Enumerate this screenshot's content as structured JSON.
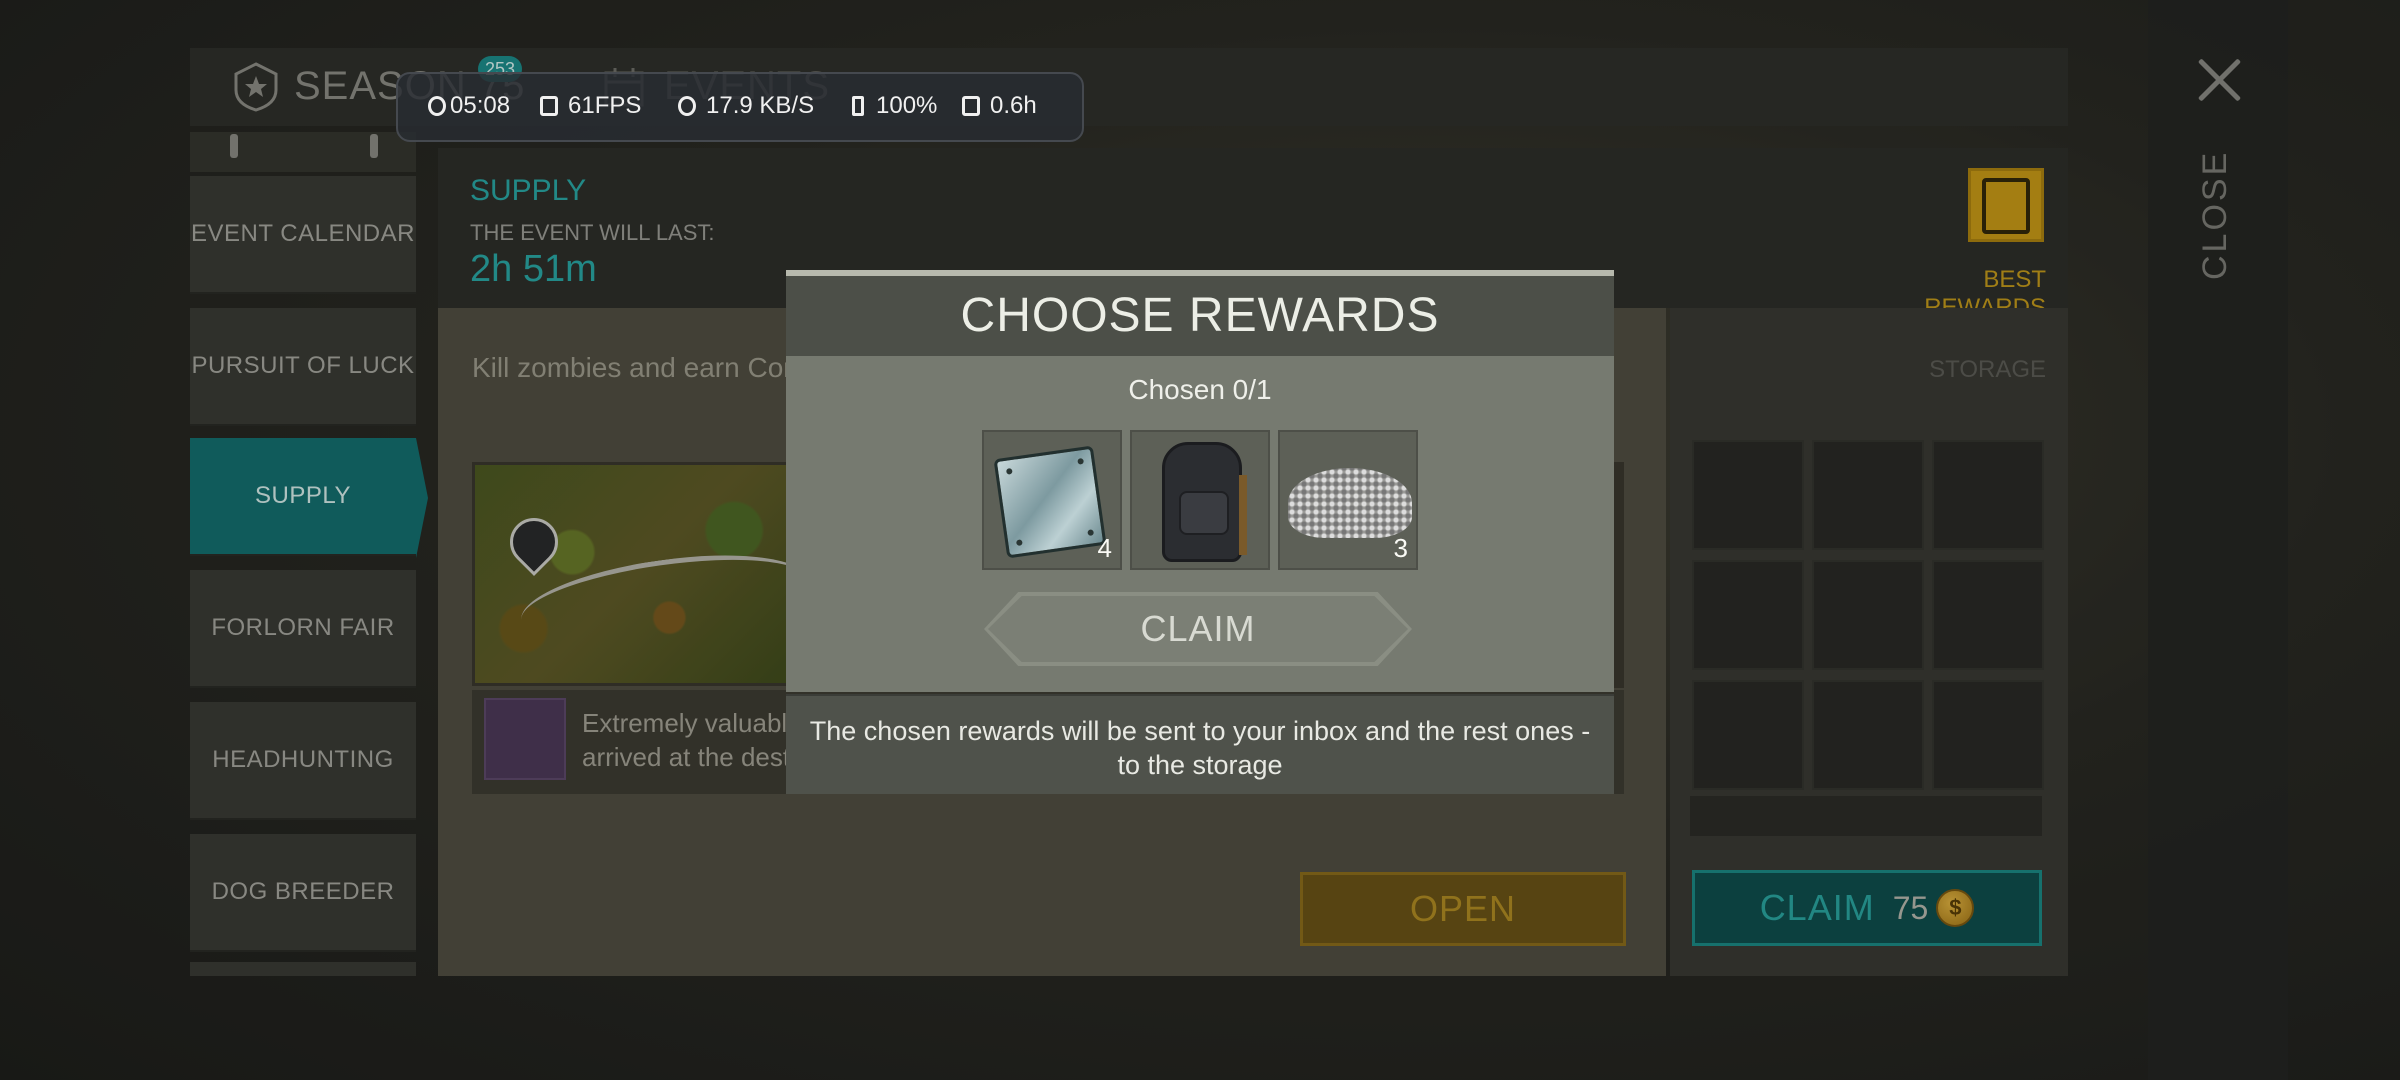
{
  "header": {
    "season_label": "SEASON 75",
    "season_badge": "253",
    "events_label": "EVENTS"
  },
  "close": {
    "label": "CLOSE"
  },
  "perf": {
    "time": "05:08",
    "fps": "61FPS",
    "net": "17.9 KB/S",
    "battery": "100%",
    "duration": "0.6h"
  },
  "sidebar": {
    "items": [
      {
        "label": "EVENT CALENDAR",
        "active": false
      },
      {
        "label": "PURSUIT OF LUCK",
        "active": false
      },
      {
        "label": "SUPPLY",
        "active": true
      },
      {
        "label": "FORLORN FAIR",
        "active": false
      },
      {
        "label": "HEADHUNTING",
        "active": false
      },
      {
        "label": "DOG BREEDER",
        "active": false
      }
    ]
  },
  "event": {
    "title": "SUPPLY",
    "last_label": "THE EVENT WILL LAST:",
    "time_left": "2h 51m",
    "description": "Kill zombies and earn Cont",
    "strip_line1": "Extremely valuable",
    "strip_line2": "arrived at the dest",
    "open_label": "OPEN",
    "best_rewards_label": "BEST REWARDS"
  },
  "storage": {
    "label": "STORAGE",
    "claim_label": "CLAIM",
    "claim_cost": "75"
  },
  "modal": {
    "title": "CHOOSE REWARDS",
    "chosen_label": "Chosen",
    "chosen_value": "0/1",
    "rewards": [
      {
        "icon": "metal-plate-icon",
        "count": "4"
      },
      {
        "icon": "backpack-icon",
        "count": ""
      },
      {
        "icon": "scrap-pile-icon",
        "count": "3"
      }
    ],
    "claim_label": "CLAIM",
    "footer_text": "The chosen rewards will be sent to your inbox and the rest ones - to the storage"
  },
  "colors": {
    "accent_teal": "#2aa8a5",
    "active_tab": "#14706f",
    "gold": "#c89a16"
  }
}
